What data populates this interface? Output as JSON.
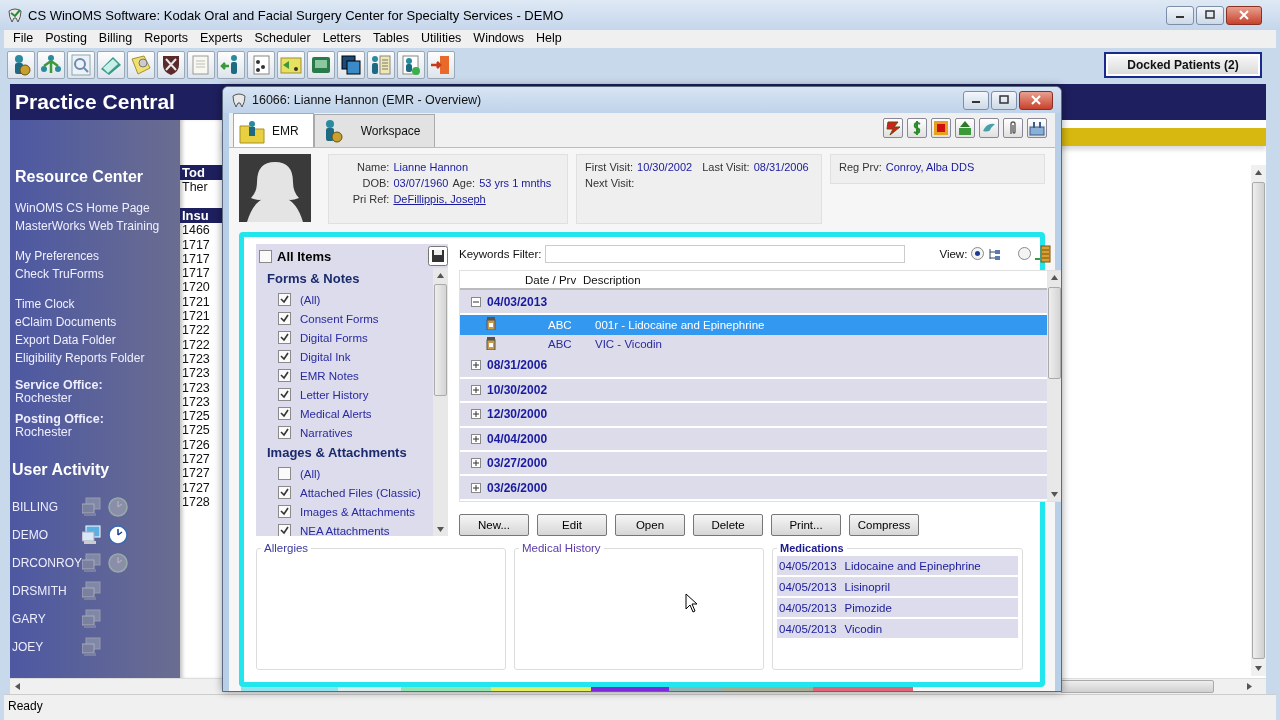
{
  "window": {
    "title": "CS WinOMS Software:  Kodak Oral and Facial Surgery Center for Specialty Services - DEMO"
  },
  "menu": [
    "File",
    "Posting",
    "Billing",
    "Reports",
    "Experts",
    "Scheduler",
    "Letters",
    "Tables",
    "Utilities",
    "Windows",
    "Help"
  ],
  "docked_button": "Docked Patients (2)",
  "practice_central": {
    "title": "Practice Central",
    "resource_heading": "Resource Center",
    "link_groups": [
      [
        "WinOMS CS Home Page",
        "MasterWorks Web Training"
      ],
      [
        "My Preferences",
        "Check TruForms"
      ],
      [
        "Time Clock",
        "eClaim Documents",
        "Export Data Folder",
        "Eligibility Reports Folder"
      ]
    ],
    "offices": [
      {
        "label": "Service Office:",
        "value": "Rochester"
      },
      {
        "label": "Posting Office:",
        "value": "Rochester"
      }
    ],
    "activity_heading": "User Activity",
    "users": [
      {
        "name": "BILLING",
        "active": false,
        "clock": true
      },
      {
        "name": "DEMO",
        "active": true,
        "clock": true
      },
      {
        "name": "DRCONROY",
        "active": false,
        "clock": true
      },
      {
        "name": "DRSMITH",
        "active": false,
        "clock": false
      },
      {
        "name": "GARY",
        "active": false,
        "clock": false
      },
      {
        "name": "JOEY",
        "active": false,
        "clock": false
      }
    ],
    "column_2": {
      "heading_1": "Tod",
      "text_1": "Ther",
      "heading_2": "Insu",
      "rows": [
        "1466",
        "1717",
        "1717",
        "1717",
        "1720",
        "1721",
        "1721",
        "1722",
        "1722",
        "1723",
        "1723",
        "1723",
        "1723",
        "1725",
        "1725",
        "1726",
        "1727",
        "1727",
        "1727",
        "1728"
      ]
    }
  },
  "emr_window": {
    "title": "16066: Lianne Hannon (EMR - Overview)",
    "tabs": [
      {
        "label": "EMR",
        "selected": true
      },
      {
        "label": "Workspace",
        "selected": false
      }
    ],
    "patient": {
      "name": {
        "label": "Name:",
        "value": "Lianne Hannon"
      },
      "dob": {
        "label": "DOB:",
        "value": "03/07/1960"
      },
      "age": {
        "label": "Age:",
        "value": "53 yrs 1 mnths"
      },
      "pri_ref": {
        "label": "Pri Ref:",
        "value": "DeFillippis, Joseph"
      }
    },
    "visits": {
      "first": {
        "label": "First Visit:",
        "value": "10/30/2002"
      },
      "last": {
        "label": "Last Visit:",
        "value": "08/31/2006"
      },
      "next": {
        "label": "Next Visit:"
      }
    },
    "reg_prv": {
      "label": "Reg Prv:",
      "value": "Conroy, Alba DDS"
    },
    "filters": {
      "all_items": {
        "label": "All Items",
        "checked": false
      },
      "groups": [
        {
          "heading": "Forms & Notes",
          "items": [
            {
              "label": "(All)",
              "checked": true
            },
            {
              "label": "Consent Forms",
              "checked": true
            },
            {
              "label": "Digital Forms",
              "checked": true
            },
            {
              "label": "Digital Ink",
              "checked": true
            },
            {
              "label": "EMR Notes",
              "checked": true
            },
            {
              "label": "Letter History",
              "checked": true
            },
            {
              "label": "Medical Alerts",
              "checked": true
            },
            {
              "label": "Narratives",
              "checked": true
            }
          ]
        },
        {
          "heading": "Images & Attachments",
          "items": [
            {
              "label": "(All)",
              "checked": false
            },
            {
              "label": "Attached Files (Classic)",
              "checked": true
            },
            {
              "label": "Images & Attachments",
              "checked": true
            },
            {
              "label": "NEA Attachments",
              "checked": true
            }
          ]
        }
      ]
    },
    "keywords_label": "Keywords Filter:",
    "view": {
      "label": "View:",
      "options": [
        {
          "kind": "tree",
          "selected": true
        },
        {
          "kind": "list",
          "selected": false
        }
      ]
    },
    "records": {
      "columns": [
        "Date / Prv",
        "Description"
      ],
      "groups": [
        {
          "date": "04/03/2013",
          "expanded": true,
          "children": [
            {
              "provider": "ABC",
              "description": "001r - Lidocaine and Epinephrine",
              "selected": true
            },
            {
              "provider": "ABC",
              "description": "VIC - Vicodin",
              "selected": false
            }
          ]
        },
        {
          "date": "08/31/2006",
          "expanded": false
        },
        {
          "date": "10/30/2002",
          "expanded": false
        },
        {
          "date": "12/30/2000",
          "expanded": false
        },
        {
          "date": "04/04/2000",
          "expanded": false
        },
        {
          "date": "03/27/2000",
          "expanded": false
        },
        {
          "date": "03/26/2000",
          "expanded": false
        }
      ]
    },
    "buttons": [
      "New...",
      "Edit",
      "Open",
      "Delete",
      "Print...",
      "Compress"
    ],
    "allergies": {
      "title": "Allergies"
    },
    "medical_history": {
      "title": "Medical History"
    },
    "medications": {
      "title": "Medications",
      "items": [
        {
          "date": "04/05/2013",
          "name": "Lidocaine and Epinephrine"
        },
        {
          "date": "04/05/2013",
          "name": "Lisinopril"
        },
        {
          "date": "04/05/2013",
          "name": "Pimozide"
        },
        {
          "date": "04/05/2013",
          "name": "Vicodin"
        }
      ]
    },
    "bottom_tabs": [
      {
        "color": "#8ee4ee"
      },
      {
        "color": "#d4eeee"
      },
      {
        "color": "#90e4b4"
      },
      {
        "color": "#e4ee64"
      },
      {
        "color": "#7a2ad8"
      },
      {
        "color": "#8cb4b4"
      },
      {
        "color": "#a4ac94"
      },
      {
        "color": "#e06478"
      }
    ]
  },
  "status_bar": {
    "text": "Ready"
  }
}
